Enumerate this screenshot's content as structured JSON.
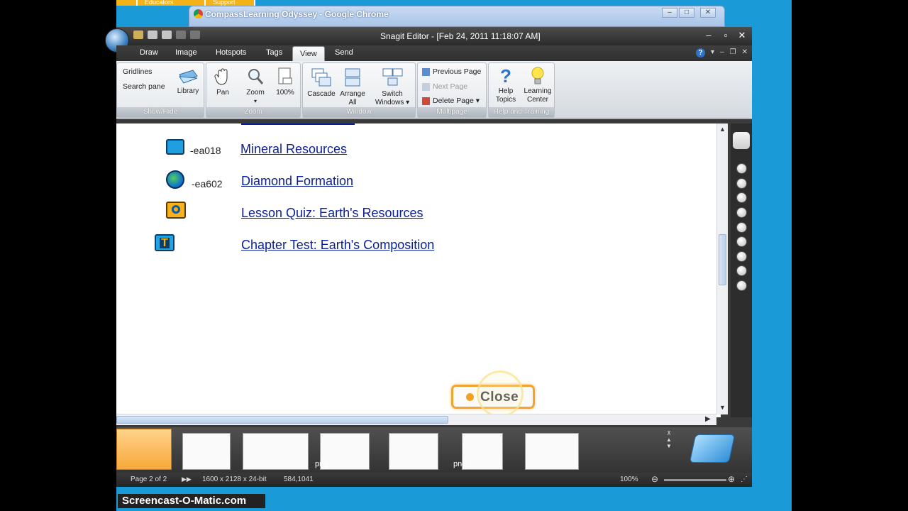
{
  "behind": {
    "tab_educators": "Educators",
    "tab_support": "Support",
    "chrome_title": "CompassLearning Odyssey - Google Chrome"
  },
  "snagit": {
    "title": "Snagit Editor - [Feb 24, 2011 11:18:07 AM]",
    "tabs": [
      "Draw",
      "Image",
      "Hotspots",
      "Tags",
      "View",
      "Send"
    ],
    "active_tab": "View",
    "ribbon": {
      "showhide": {
        "label": "Show/Hide",
        "gridlines": "Gridlines",
        "search_pane": "Search pane",
        "library": "Library"
      },
      "zoom": {
        "label": "Zoom",
        "pan": "Pan",
        "zoom": "Zoom",
        "hundred": "100%"
      },
      "window": {
        "label": "Window",
        "cascade": "Cascade",
        "arrange_1": "Arrange",
        "arrange_2": "All",
        "switch_1": "Switch",
        "switch_2": "Windows ▾"
      },
      "multipage": {
        "label": "Multipage",
        "previous_page": "Previous Page",
        "next_page": "Next Page",
        "delete_page": "Delete Page ▾"
      },
      "help": {
        "label": "Help and Training",
        "help_1": "Help",
        "help_2": "Topics",
        "learning_1": "Learning",
        "learning_2": "Center"
      }
    }
  },
  "content": {
    "items": [
      {
        "code": "-ea018",
        "title": "Mineral Resources"
      },
      {
        "code": "-ea602",
        "title": "Diamond Formation"
      },
      {
        "code": "",
        "title": "Lesson Quiz: Earth's Resources"
      },
      {
        "code": "",
        "title": "Chapter Test: Earth's Composition"
      }
    ],
    "close_label": "Close"
  },
  "tray": {
    "png_1": "png",
    "png_2": "png"
  },
  "status": {
    "page": "Page 2 of 2",
    "dimensions": "1600 x 2128 x 24-bit",
    "coords": "584,1041",
    "zoom": "100%"
  },
  "watermark": "Screencast-O-Matic.com",
  "colors": {
    "link": "#0a1e96",
    "accent": "#f1a531",
    "desktop": "#1a9ad6"
  }
}
